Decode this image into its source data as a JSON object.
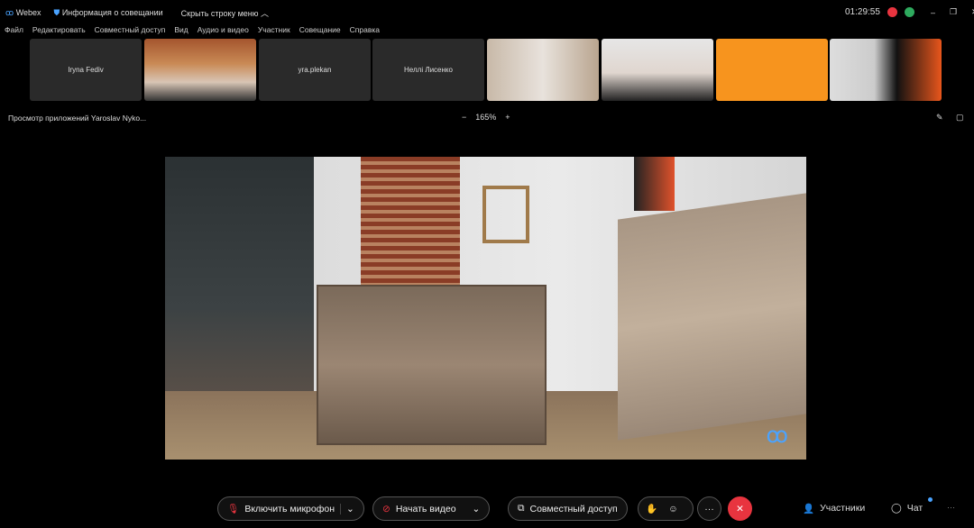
{
  "titlebar": {
    "app": "Webex",
    "meeting_info": "Информация о совещании",
    "hide_menu": "Скрыть строку меню",
    "time": "01:29:55"
  },
  "menu": [
    "Файл",
    "Редактировать",
    "Совместный доступ",
    "Вид",
    "Аудио и видео",
    "Участник",
    "Совещание",
    "Справка"
  ],
  "participants": [
    "Iryna Fediv",
    "",
    "yra.plekan",
    "Неллі Лисенко",
    "",
    "",
    "",
    ""
  ],
  "share_bar": {
    "title": "Просмотр приложений Yaroslav Nyko...",
    "zoom": "165%",
    "minus": "−",
    "plus": "+"
  },
  "controls": {
    "mic": "Включить микрофон",
    "video": "Начать видео",
    "share": "Совместный доступ",
    "participants": "Участники",
    "chat": "Чат",
    "more": "···"
  },
  "colors": {
    "end": "#e8343f",
    "accent": "#f7941e",
    "green": "#2eaa5e"
  }
}
